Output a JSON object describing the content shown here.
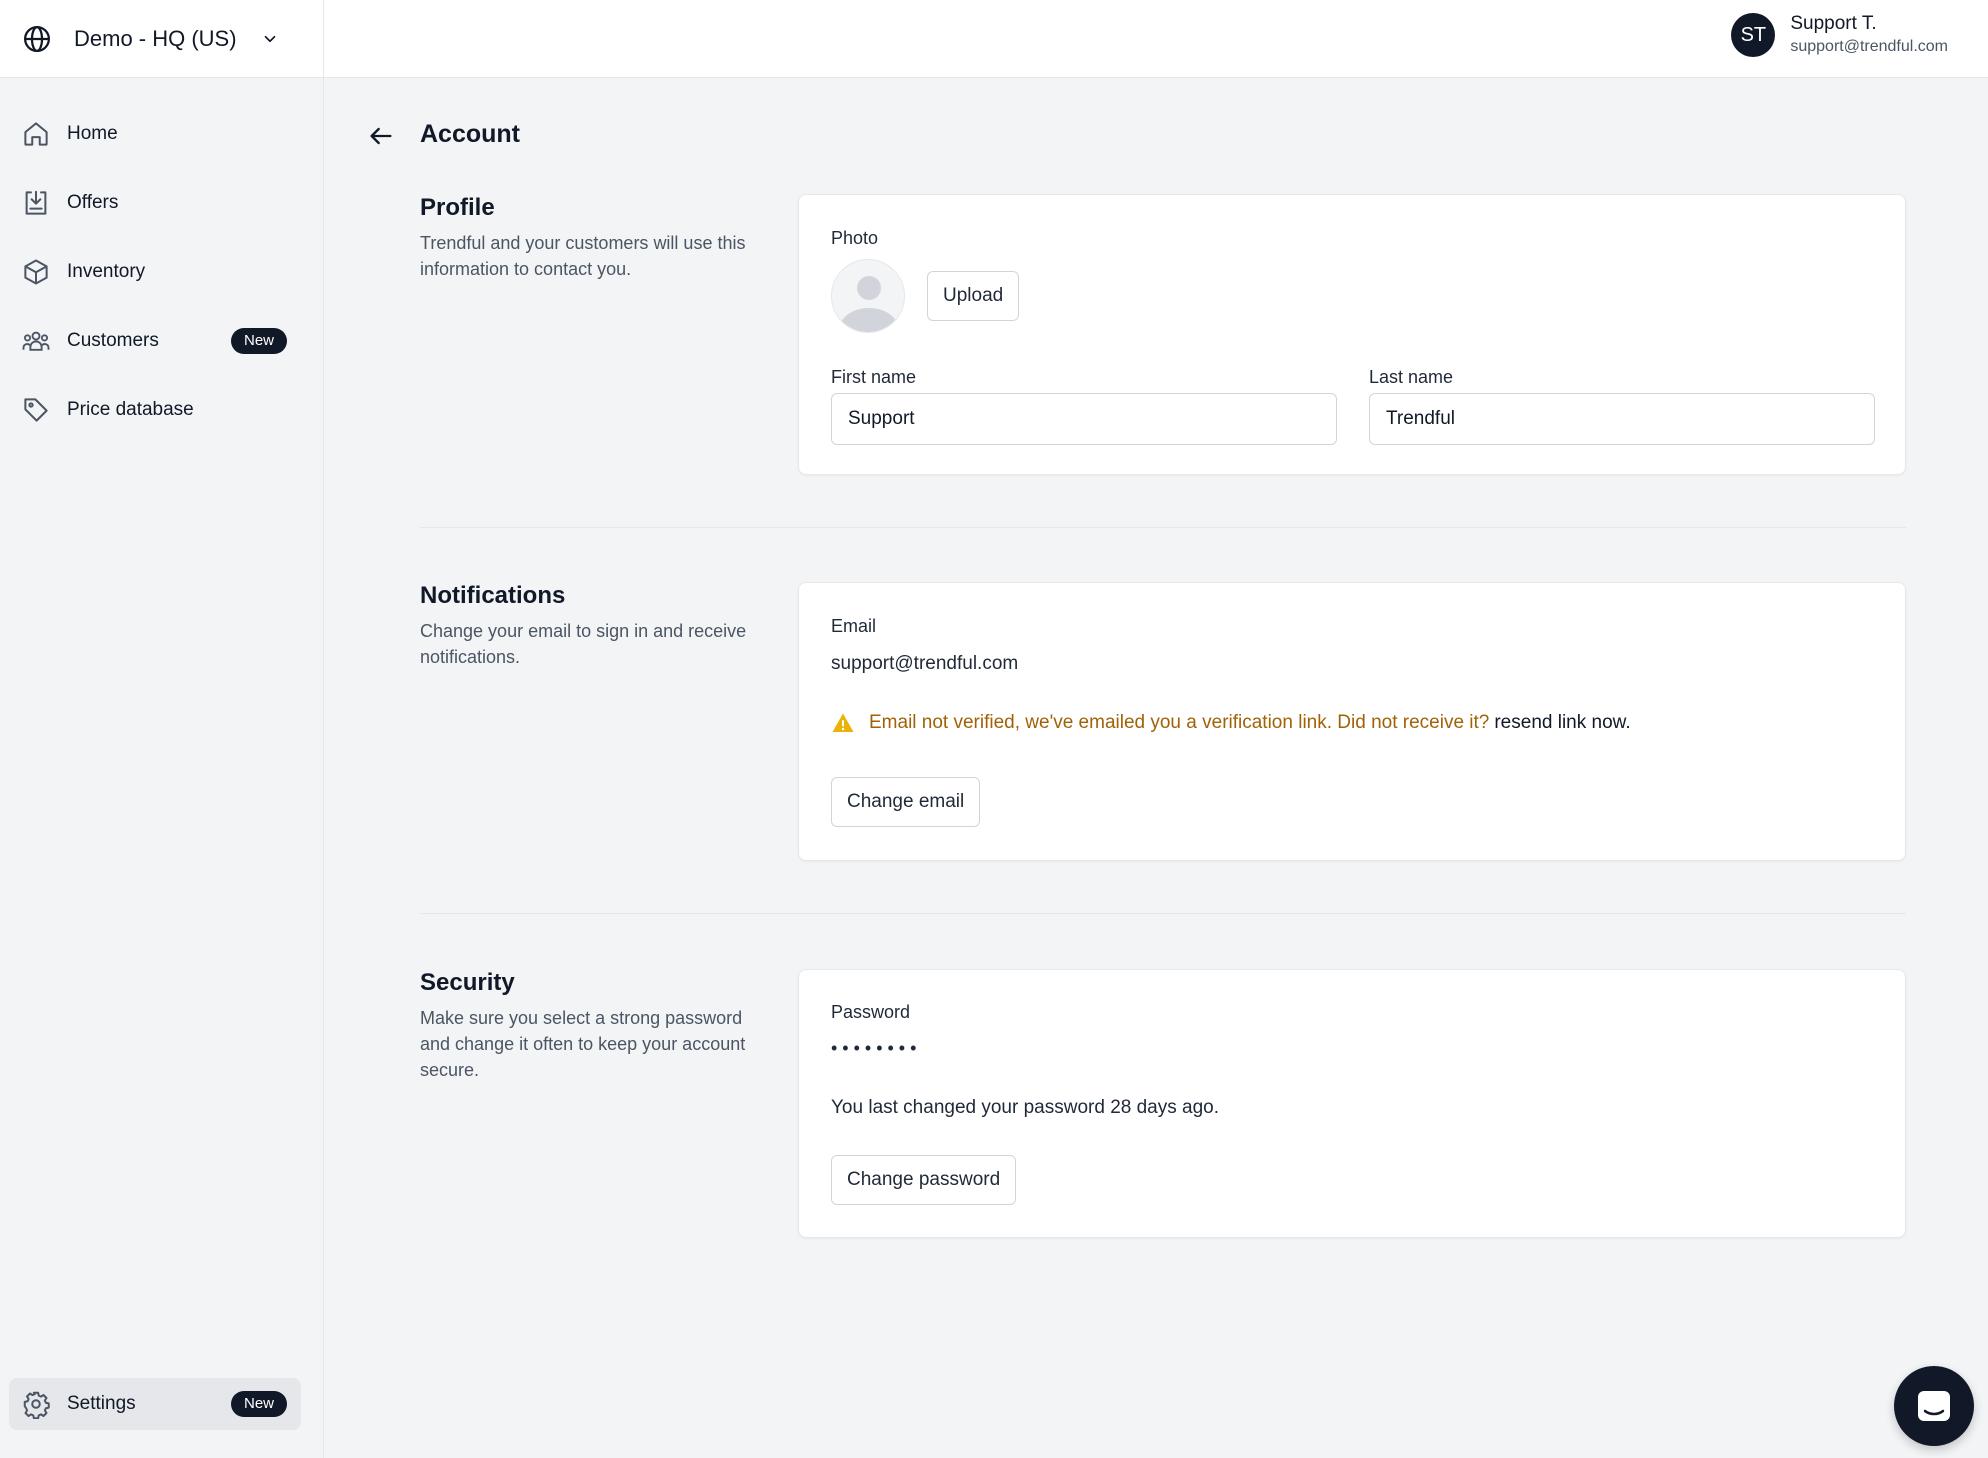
{
  "store_switcher": {
    "name": "Demo - HQ (US)",
    "icon": "globe-icon"
  },
  "sidebar": {
    "items": [
      {
        "label": "Home",
        "icon": "home-icon"
      },
      {
        "label": "Offers",
        "icon": "offers-icon"
      },
      {
        "label": "Inventory",
        "icon": "box-icon"
      },
      {
        "label": "Customers",
        "icon": "users-icon",
        "badge": "New"
      },
      {
        "label": "Price database",
        "icon": "tag-icon"
      }
    ],
    "settings": {
      "label": "Settings",
      "icon": "gear-icon",
      "badge": "New",
      "active": true
    }
  },
  "user": {
    "initials": "ST",
    "name": "Support T.",
    "email": "support@trendful.com"
  },
  "page": {
    "title": "Account"
  },
  "profile": {
    "title": "Profile",
    "description": "Trendful and your customers will use this information to contact you.",
    "photo_label": "Photo",
    "upload_label": "Upload",
    "first_name_label": "First name",
    "first_name_value": "Support",
    "last_name_label": "Last name",
    "last_name_value": "Trendful"
  },
  "notifications": {
    "title": "Notifications",
    "description": "Change your email to sign in and receive notifications.",
    "email_label": "Email",
    "email_value": "support@trendful.com",
    "warning_text": "Email not verified, we've emailed you a verification link. Did not receive it?",
    "resend_link": "resend link now.",
    "change_email_label": "Change email"
  },
  "security": {
    "title": "Security",
    "description": "Make sure you select a strong password and change it often to keep your account secure.",
    "password_label": "Password",
    "password_mask": "••••••••",
    "last_changed": "You last changed your password 28 days ago.",
    "change_password_label": "Change password"
  },
  "colors": {
    "accent_dark": "#111827",
    "warning": "#a16207",
    "warning_icon": "#eab308",
    "background": "#f3f4f6"
  }
}
